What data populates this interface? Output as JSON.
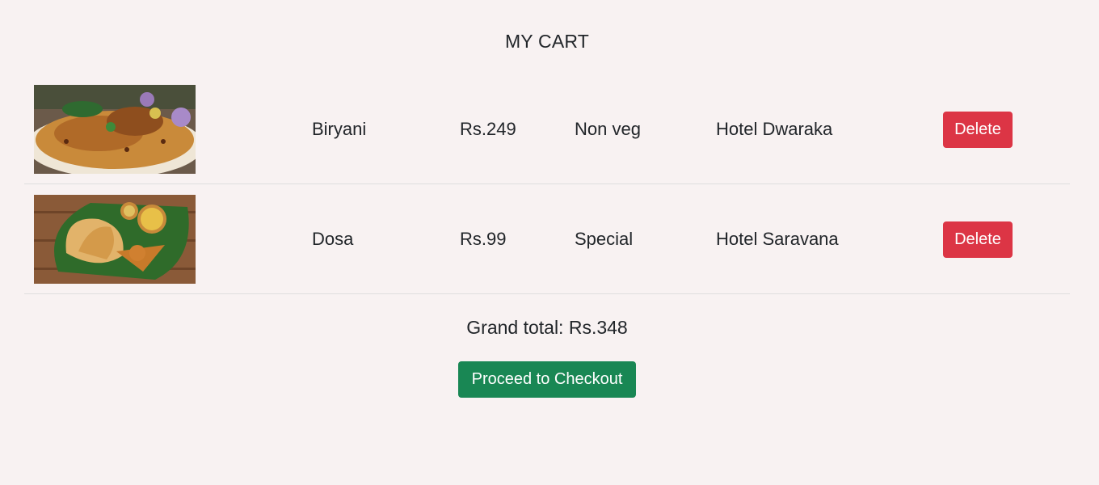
{
  "page": {
    "title": "MY CART",
    "background": "#f8f2f2"
  },
  "cart": {
    "items": [
      {
        "image": "biryani-photo",
        "name": "Biryani",
        "price": "Rs.249",
        "type": "Non veg",
        "hotel": "Hotel Dwaraka",
        "delete_label": "Delete"
      },
      {
        "image": "dosa-photo",
        "name": "Dosa",
        "price": "Rs.99",
        "type": "Special",
        "hotel": "Hotel Saravana",
        "delete_label": "Delete"
      }
    ]
  },
  "summary": {
    "grand_total": "Grand total: Rs.348",
    "checkout_label": "Proceed to Checkout"
  },
  "colors": {
    "delete": "#dc3545",
    "checkout": "#198754",
    "text": "#212529"
  }
}
